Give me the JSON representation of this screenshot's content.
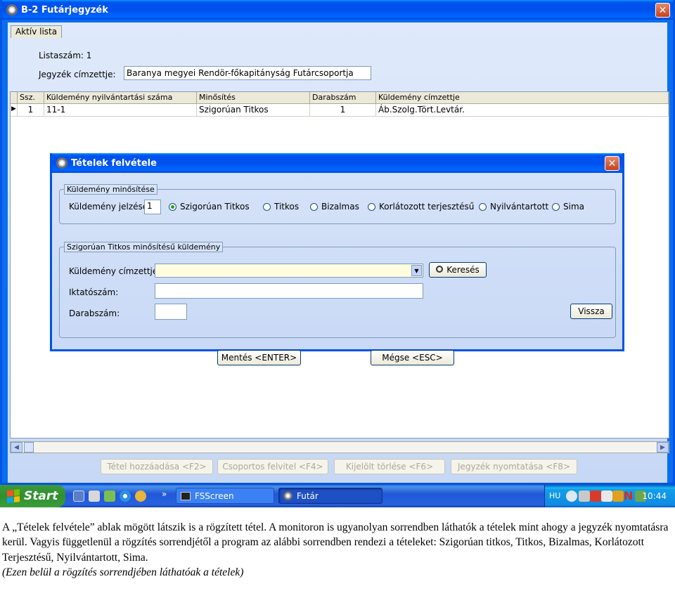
{
  "main_window": {
    "title": "B-2 Futárjegyzék",
    "close_glyph": "✕",
    "tab_label": "Aktív lista",
    "list_number_label": "Listaszám: 1",
    "recipient_label": "Jegyzék címzettje:",
    "recipient_value": "Baranya megyei Rendör-főkapitányság Futárcsoportja",
    "grid": {
      "columns": [
        "Ssz.",
        "Küldemény nyilvántartási száma",
        "Minősítés",
        "Darabszám",
        "Küldemény címzettje"
      ],
      "rows": [
        {
          "ssz": "1",
          "number": "11-1",
          "classification": "Szigorúan Titkos",
          "count": "1",
          "recipient": "Áb.Szolg.Tört.Levtár."
        }
      ],
      "current_row_marker": "▶"
    },
    "buttons": {
      "add_item": "Tétel hozzáadása <F2>",
      "group_entry": "Csoportos felvitel <F4>",
      "delete_selected": "Kijelölt törlése <F6>",
      "print_list": "Jegyzék nyomtatása <F8>"
    }
  },
  "dialog": {
    "title": "Tételek felvétele",
    "close_glyph": "✕",
    "classification_group": {
      "legend": "Küldemény minősítése",
      "label": "Küldemény jelzése:",
      "value": "1",
      "options": [
        "Szigorúan Titkos",
        "Titkos",
        "Bizalmas",
        "Korlátozott terjesztésű",
        "Nyilvántartott",
        "Sima"
      ],
      "selected": "Szigorúan Titkos"
    },
    "detail_group": {
      "legend": "Szigorúan Titkos minősítésű küldemény",
      "recipient_label": "Küldemény címzettje:",
      "recipient_value": "",
      "search_button": "Keresés",
      "filing_label": "Iktatószám:",
      "filing_value": "",
      "count_label": "Darabszám:",
      "count_value": "",
      "back_button": "Vissza"
    },
    "save_button": "Mentés <ENTER>",
    "cancel_button": "Mégse <ESC>"
  },
  "taskbar": {
    "start_label": "Start",
    "chevron": "»",
    "tasks": [
      "FSScreen",
      "Futár"
    ],
    "language": "HU",
    "clock": "10:44"
  },
  "caption": {
    "line1": "A „Tételek felvétele” ablak mögött látszik is a rögzített tétel. A monitoron is ugyanolyan sorrendben láthatók a tételek mint ahogy a jegyzék nyomtatásra kerül. Vagyis függetlenül a rögzítés sorrendjétől a program az alábbi sorrendben rendezi a tételeket: Szigorúan titkos, Titkos, Bizalmas, Korlátozott Terjesztésű, Nyilvántartott, Sima.",
    "line2": "(Ezen belül a rögzítés sorrendjében láthatóak a tételek)"
  },
  "colors": {
    "title_bar": "#0054e3",
    "close_button": "#c6401a",
    "start_button": "#2f8f2f",
    "combo_background": "#fffde0"
  }
}
